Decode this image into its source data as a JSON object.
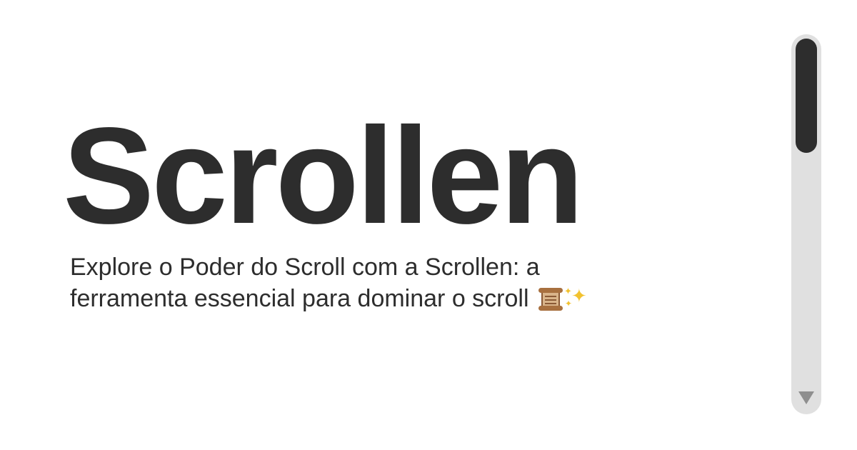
{
  "hero": {
    "title": "Scrollen"
  },
  "tagline": {
    "strong": "Explore o Poder do Scroll com a Scrollen:",
    "rest": " a ferramenta essencial para dominar o scroll",
    "emoji_icons": [
      "scroll-icon",
      "sparkles-icon"
    ]
  },
  "scrollbar": {
    "thumb_color": "#2d2d2d",
    "track_color": "#e0e0e0",
    "arrow_color": "#8f8f8f",
    "arrow_icon": "triangle-down-icon"
  },
  "colors": {
    "background": "#ffffff",
    "text": "#2d2d2d"
  }
}
